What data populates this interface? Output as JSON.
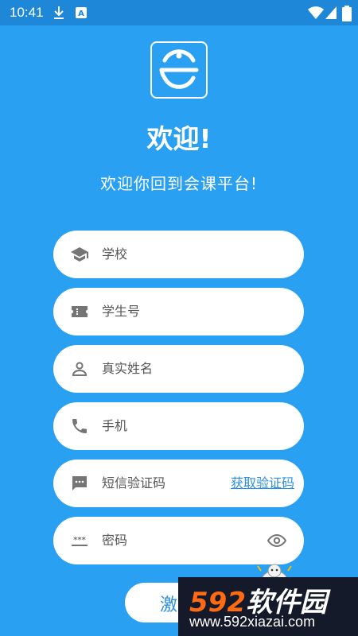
{
  "status_bar": {
    "time": "10:41",
    "icons": [
      "download-icon",
      "a-notification-icon",
      "wifi-icon",
      "signal-icon",
      "battery-icon"
    ]
  },
  "header": {
    "title": "欢迎!",
    "subtitle": "欢迎你回到会课平台!"
  },
  "form": {
    "school": {
      "label": "学校",
      "icon": "graduation-cap-icon"
    },
    "student_id": {
      "label": "学生号",
      "icon": "ticket-icon"
    },
    "real_name": {
      "label": "真实姓名",
      "icon": "person-icon"
    },
    "phone": {
      "label": "手机",
      "icon": "phone-icon"
    },
    "sms_code": {
      "label": "短信验证码",
      "icon": "sms-icon",
      "action": "获取验证码"
    },
    "password": {
      "label": "密码",
      "icon": "password-icon",
      "toggle_icon": "eye-icon"
    }
  },
  "submit_button": {
    "label": "激"
  },
  "watermark": {
    "number": "592",
    "brand": "软件园",
    "url": "www.592xiazai.com"
  },
  "colors": {
    "background": "#2aa0f2",
    "status_bar": "#1f87d8",
    "field": "#ffffff",
    "link": "#2a8ee0",
    "icon": "#757575"
  }
}
